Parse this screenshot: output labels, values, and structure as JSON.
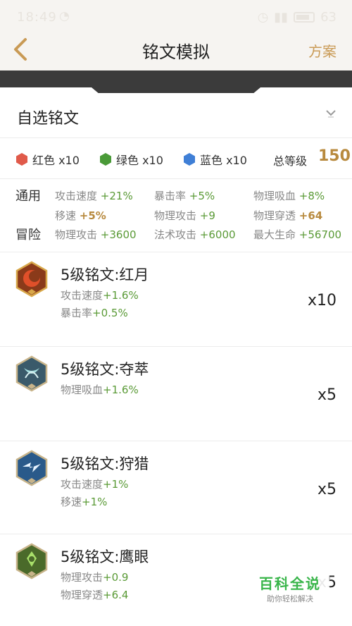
{
  "status_bar": {
    "time": "18:49",
    "battery": "63"
  },
  "header": {
    "title": "铭文模拟",
    "plan_label": "方案"
  },
  "selector": {
    "label": "自选铭文"
  },
  "colors": [
    {
      "label": "红色 x10",
      "color": "#e05a4a"
    },
    {
      "label": "绿色 x10",
      "color": "#4a9a38"
    },
    {
      "label": "蓝色 x10",
      "color": "#3f7fd6"
    }
  ],
  "total": {
    "label": "总等级",
    "value": "150"
  },
  "stats": {
    "general_label": "通用",
    "adventure_label": "冒险",
    "general": [
      {
        "name": "攻击速度",
        "value": "+21%"
      },
      {
        "name": "暴击率",
        "value": "+5%"
      },
      {
        "name": "物理吸血",
        "value": "+8%"
      },
      {
        "name": "移速",
        "value": "+5%"
      },
      {
        "name": "物理攻击",
        "value": "+9"
      },
      {
        "name": "物理穿透",
        "value": "+64"
      }
    ],
    "adventure": [
      {
        "name": "物理攻击",
        "value": "+3600"
      },
      {
        "name": "法术攻击",
        "value": "+6000"
      },
      {
        "name": "最大生命",
        "value": "+56700"
      }
    ]
  },
  "inscriptions": [
    {
      "name": "5级铭文:红月",
      "attrs": [
        {
          "name": "攻击速度",
          "value": "+1.6%"
        },
        {
          "name": "暴击率",
          "value": "+0.5%"
        }
      ],
      "count": "x10",
      "icon": "red-moon-icon"
    },
    {
      "name": "5级铭文:夺萃",
      "attrs": [
        {
          "name": "物理吸血",
          "value": "+1.6%"
        }
      ],
      "count": "x5",
      "icon": "duocui-icon"
    },
    {
      "name": "5级铭文:狩猎",
      "attrs": [
        {
          "name": "攻击速度",
          "value": "+1%"
        },
        {
          "name": "移速",
          "value": "+1%"
        }
      ],
      "count": "x5",
      "icon": "hunt-icon"
    },
    {
      "name": "5级铭文:鹰眼",
      "attrs": [
        {
          "name": "物理攻击",
          "value": "+0.9"
        },
        {
          "name": "物理穿透",
          "value": "+6.4"
        }
      ],
      "count": "x5",
      "icon": "eagle-eye-icon"
    }
  ],
  "watermark": {
    "main": "百科全说",
    "sub": "助你轻松解决"
  }
}
